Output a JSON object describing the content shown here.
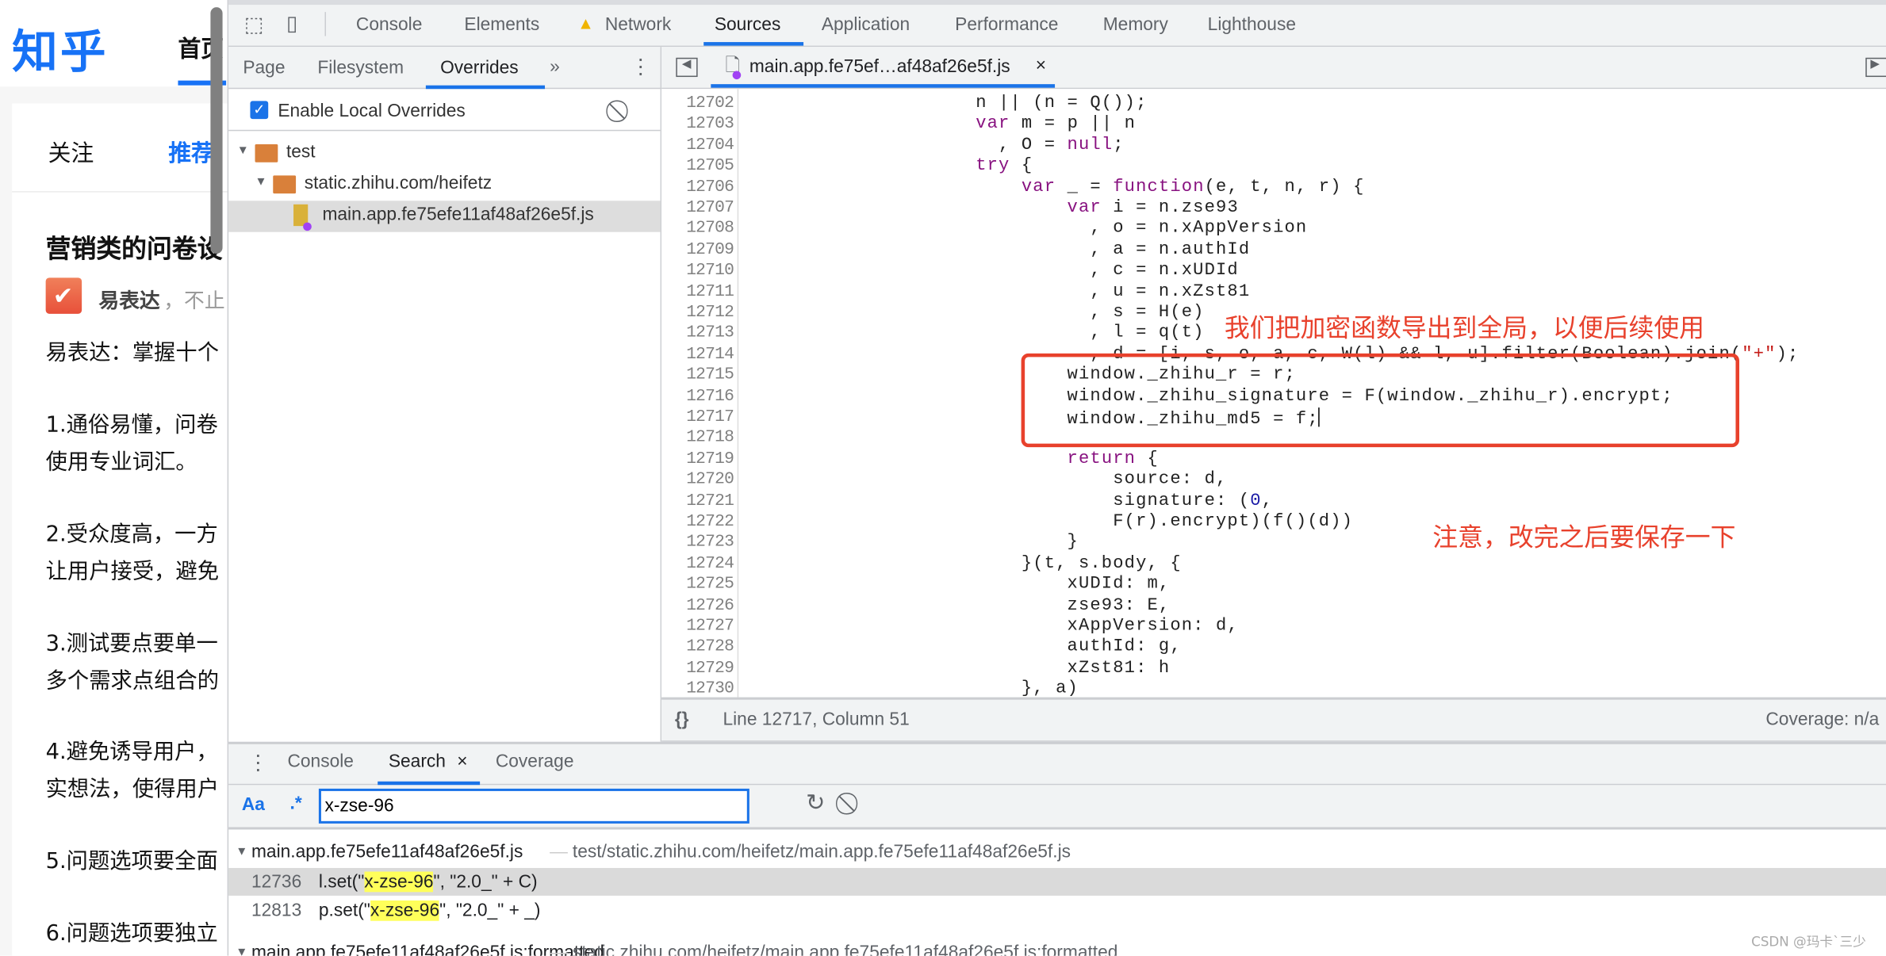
{
  "page": {
    "logo": "知乎",
    "nav_home": "首页",
    "feed_tabs": [
      "关注",
      "推荐"
    ],
    "article_title": "营销类的问卷设",
    "author": "易表达",
    "author_tail": "，不止",
    "paragraphs": [
      "易表达：掌握十个",
      "1.通俗易懂，问卷",
      "使用专业词汇。",
      "2.受众度高，一方",
      "让用户接受，避免",
      "3.测试要点要单一",
      "多个需求点组合的",
      "4.避免诱导用户，",
      "实想法，使得用户",
      "5.问题选项要全面",
      "6.问题选项要独立"
    ]
  },
  "devtools": {
    "main_tabs": [
      "Console",
      "Elements",
      "Network",
      "Sources",
      "Application",
      "Performance",
      "Memory",
      "Lighthouse"
    ],
    "active_tab": "Sources",
    "nav_tabs": [
      "Page",
      "Filesystem",
      "Overrides"
    ],
    "more_tabs": "»",
    "enable_overrides": {
      "label": "Enable Local Overrides",
      "checked": true
    },
    "tree": [
      {
        "label": "test",
        "type": "folder"
      },
      {
        "label": "static.zhihu.com/heifetz",
        "type": "folder"
      },
      {
        "label": "main.app.fe75efe11af48af26e5f.js",
        "type": "file",
        "selected": true
      }
    ],
    "editor_tab": "main.app.fe75ef…af48af26e5f.js",
    "code": [
      {
        "n": "12702",
        "text": "                    n || (n = Q());"
      },
      {
        "n": "12703",
        "text": "                    var m = p || n"
      },
      {
        "n": "12704",
        "text": "                      , O = null;"
      },
      {
        "n": "12705",
        "text": "                    try {"
      },
      {
        "n": "12706",
        "text": "                        var _ = function(e, t, n, r) {"
      },
      {
        "n": "12707",
        "text": "                            var i = n.zse93"
      },
      {
        "n": "12708",
        "text": "                              , o = n.xAppVersion"
      },
      {
        "n": "12709",
        "text": "                              , a = n.authId"
      },
      {
        "n": "12710",
        "text": "                              , c = n.xUDId"
      },
      {
        "n": "12711",
        "text": "                              , u = n.xZst81"
      },
      {
        "n": "12712",
        "text": "                              , s = H(e)"
      },
      {
        "n": "12713",
        "text": "                              , l = q(t)"
      },
      {
        "n": "12714",
        "text": "                              , d = [i, s, o, a, c, W(l) && l, u].filter(Boolean).join(\"+\");"
      },
      {
        "n": "12715",
        "text": "                            window._zhihu_r = r;"
      },
      {
        "n": "12716",
        "text": "                            window._zhihu_signature = F(window._zhihu_r).encrypt;"
      },
      {
        "n": "12717",
        "text": "                            window._zhihu_md5 = f;",
        "caret": true
      },
      {
        "n": "12718",
        "text": ""
      },
      {
        "n": "12719",
        "text": "                            return {"
      },
      {
        "n": "12720",
        "text": "                                source: d,"
      },
      {
        "n": "12721",
        "text": "                                signature: (0,"
      },
      {
        "n": "12722",
        "text": "                                F(r).encrypt)(f()(d))"
      },
      {
        "n": "12723",
        "text": "                            }"
      },
      {
        "n": "12724",
        "text": "                        }(t, s.body, {"
      },
      {
        "n": "12725",
        "text": "                            xUDId: m,"
      },
      {
        "n": "12726",
        "text": "                            zse93: E,"
      },
      {
        "n": "12727",
        "text": "                            xAppVersion: d,"
      },
      {
        "n": "12728",
        "text": "                            authId: g,"
      },
      {
        "n": "12729",
        "text": "                            xZst81: h"
      },
      {
        "n": "12730",
        "text": "                        }, a)"
      }
    ],
    "annotations": [
      "我们把加密函数导出到全局，以便后续使用",
      "注意，改完之后要保存一下"
    ],
    "annotation_color": "#e8412c",
    "status": {
      "format_icon": "{}",
      "position": "Line 12717, Column 51",
      "coverage": "Coverage: n/a"
    },
    "drawer_tabs": [
      "Console",
      "Search",
      "Coverage"
    ],
    "active_drawer_tab": "Search",
    "search": {
      "match_case": "Aa",
      "regex": ".*",
      "query": "x-zse-96",
      "results": [
        {
          "file": "main.app.fe75efe11af48af26e5f.js",
          "sep": "—",
          "path": "test/static.zhihu.com/heifetz/main.app.fe75efe11af48af26e5f.js",
          "matches": [
            {
              "line": "12736",
              "pre": "l.set(\"",
              "hit": "x-zse-96",
              "post": "\", \"2.0_\" + C)",
              "selected": true
            },
            {
              "line": "12813",
              "pre": "p.set(\"",
              "hit": "x-zse-96",
              "post": "\", \"2.0_\" + _)"
            }
          ]
        },
        {
          "file": "main.app.fe75efe11af48af26e5f.js:formatted",
          "sep": "—",
          "path": "static.zhihu.com/heifetz/main.app.fe75efe11af48af26e5f.js:formatted"
        }
      ]
    }
  },
  "watermark": "CSDN @玛卡`三少"
}
